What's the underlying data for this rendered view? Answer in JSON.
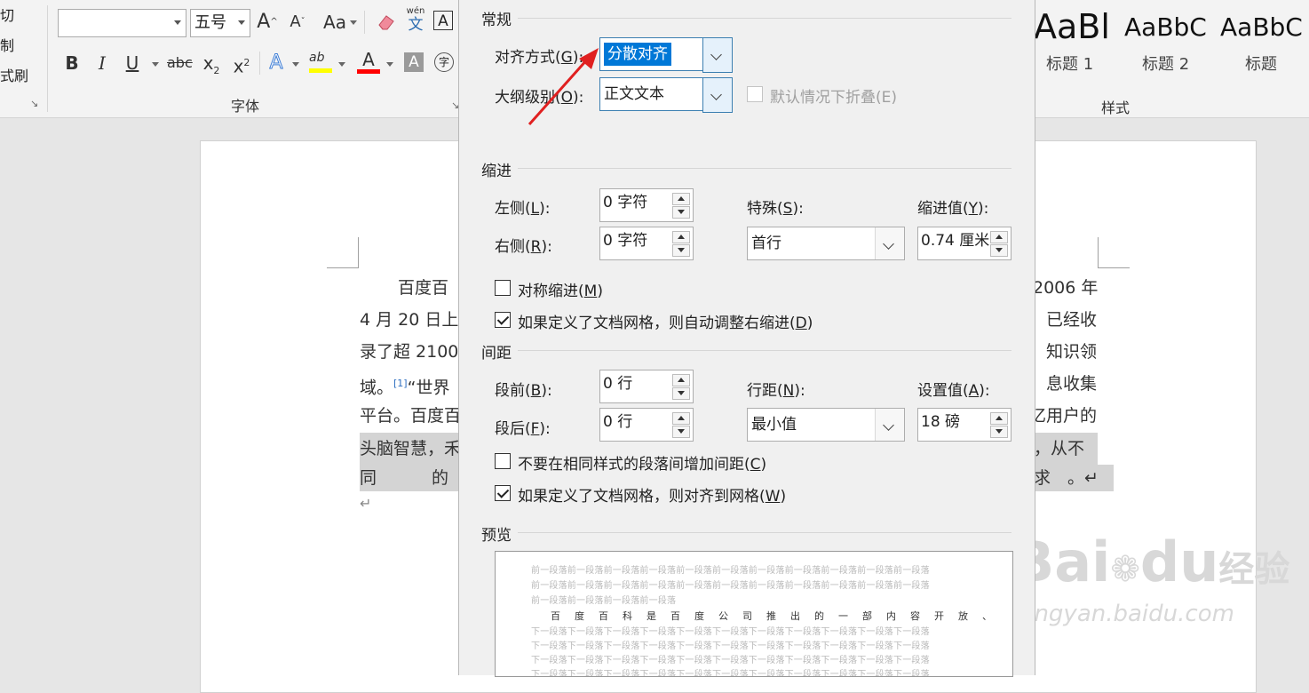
{
  "ribbon": {
    "clipboard": {
      "cut": "切",
      "copy": "制",
      "format_painter": "式刷"
    },
    "font": {
      "font_name": "",
      "font_size": "五号",
      "grow": "A",
      "shrink": "A",
      "case": "Aa",
      "phonetic_top": "wén",
      "phonetic_bottom": "文",
      "border_char": "A",
      "bold": "B",
      "italic": "I",
      "underline": "U",
      "strike": "abc",
      "subscript": "x",
      "sub_mark": "2",
      "superscript": "x",
      "sup_mark": "2",
      "effects": "A",
      "highlight": "ab",
      "font_color": "A",
      "shading": "A",
      "enclose": "字",
      "group_label": "字体"
    },
    "styles": {
      "samples": [
        "AaBl",
        "AaBbC",
        "AaBbC"
      ],
      "names": [
        "标题 1",
        "标题 2",
        "标题"
      ],
      "group_label": "样式"
    }
  },
  "document": {
    "lines": [
      {
        "left": "百度百",
        "right": "2006 年"
      },
      {
        "left": "4 月 20 日上",
        "right": "已经收"
      },
      {
        "left": "录了超 2100",
        "right": "知识领"
      },
      {
        "left": "域。",
        "footnote": "[1]",
        "left2": "“世界",
        "right": "息收集"
      },
      {
        "left": "平台。百度百",
        "right": "亿用户的"
      },
      {
        "left": "头脑智慧，禾",
        "right": "，从不"
      },
      {
        "left": "同　　的　　",
        "right": "求　。↵"
      }
    ],
    "para_mark": "↵"
  },
  "dialog": {
    "general": {
      "title": "常规",
      "alignment_label": "对齐方式(",
      "alignment_key": "G",
      "alignment_value": "分散对齐",
      "outline_label": "大纲级别(",
      "outline_key": "O",
      "outline_value": "正文文本",
      "collapse_label": "默认情况下折叠(E)"
    },
    "indent": {
      "title": "缩进",
      "left_label": "左侧(",
      "left_key": "L",
      "left_value": "0 字符",
      "right_label": "右侧(",
      "right_key": "R",
      "right_value": "0 字符",
      "special_label": "特殊(",
      "special_key": "S",
      "special_value": "首行",
      "by_label": "缩进值(",
      "by_key": "Y",
      "by_value": "0.74 厘米",
      "mirror_label": "对称缩进(",
      "mirror_key": "M",
      "auto_adjust_label": "如果定义了文档网格，则自动调整右缩进(",
      "auto_adjust_key": "D"
    },
    "spacing": {
      "title": "间距",
      "before_label": "段前(",
      "before_key": "B",
      "before_value": "0 行",
      "after_label": "段后(",
      "after_key": "F",
      "after_value": "0 行",
      "line_label": "行距(",
      "line_key": "N",
      "line_value": "最小值",
      "at_label": "设置值(",
      "at_key": "A",
      "at_value": "18 磅",
      "no_space_label": "不要在相同样式的段落间增加间距(",
      "no_space_key": "C",
      "snap_label": "如果定义了文档网格，则对齐到网格(",
      "snap_key": "W"
    },
    "preview": {
      "title": "预览",
      "prev_lines": [
        "前一段落前一段落前一段落前一段落前一段落前一段落前一段落前一段落前一段落前一段落前一段落",
        "前一段落前一段落前一段落前一段落前一段落前一段落前一段落前一段落前一段落前一段落前一段落",
        "前一段落前一段落前一段落前一段落"
      ],
      "main_line": "百度百科是百度公司推出的一部内容开放、",
      "next_lines": [
        "下一段落下一段落下一段落下一段落下一段落下一段落下一段落下一段落下一段落下一段落下一段落",
        "下一段落下一段落下一段落下一段落下一段落下一段落下一段落下一段落下一段落下一段落下一段落",
        "下一段落下一段落下一段落下一段落下一段落下一段落下一段落下一段落下一段落下一段落下一段落",
        "下一段落下一段落下一段落下一段落下一段落下一段落下一段落下一段落下一段落下一段落下一段落"
      ]
    }
  },
  "watermark": {
    "brand": "Bai",
    "brand2": "du",
    "suffix": "经验",
    "url": "jingyan.baidu.com"
  },
  "colors": {
    "accent": "#0078d7",
    "arrow": "#e02020",
    "highlight_bar": "#ffff00",
    "font_color_bar": "#ff0000"
  }
}
